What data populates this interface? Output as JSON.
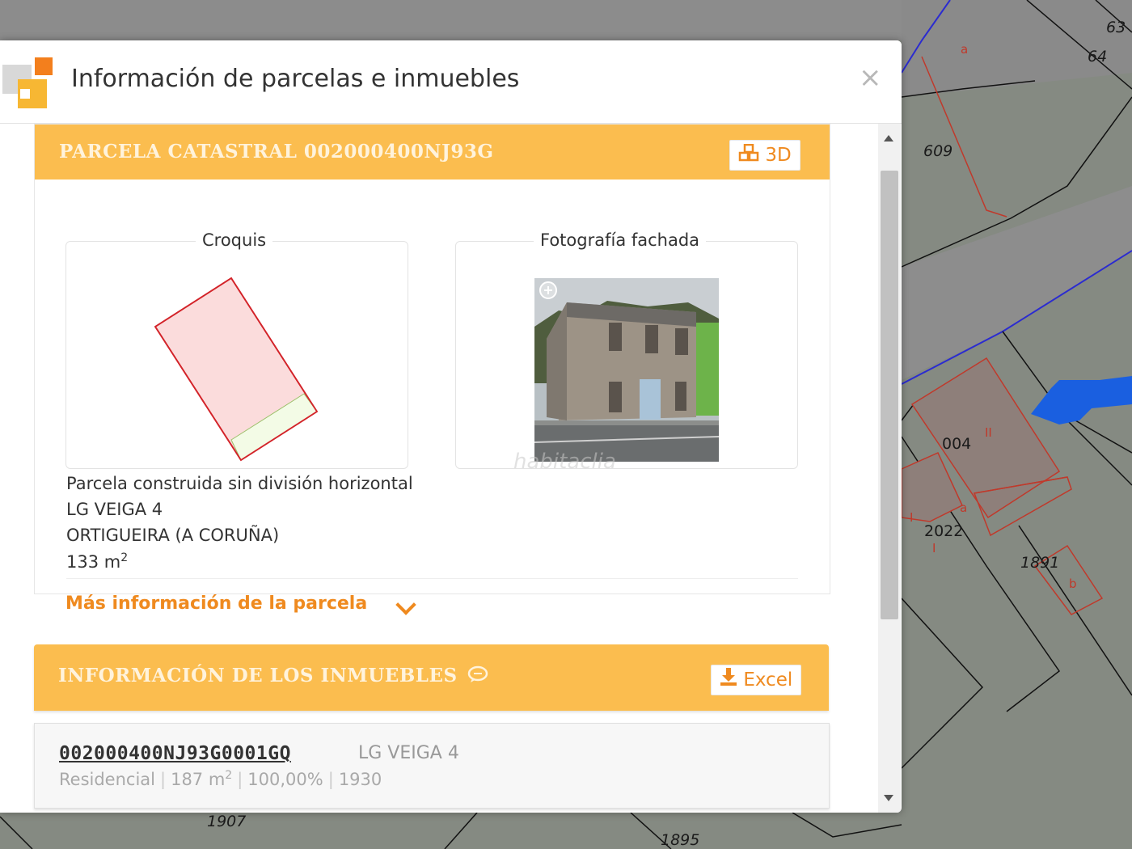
{
  "map": {
    "parcel_labels": [
      "63",
      "64",
      "609",
      "004",
      "2022",
      "1891",
      "1907",
      "1895"
    ],
    "small_labels": [
      "a",
      "a",
      "b",
      "I",
      "II",
      "I",
      "b"
    ]
  },
  "modal": {
    "title": "Información de parcelas e inmuebles",
    "close_symbol": "×"
  },
  "parcel_section": {
    "title": "PARCELA CATASTRAL 002000400NJ93G",
    "button_3d": "3D",
    "sketch_label": "Croquis",
    "photo_label": "Fotografía fachada",
    "description": "Parcela construida sin división horizontal",
    "address": "LG VEIGA 4",
    "municipality": "ORTIGUEIRA (A CORUÑA)",
    "area_value": "133 m",
    "area_unit_sup": "2",
    "more_info": "Más información de la parcela",
    "watermark": "habitaclia"
  },
  "properties_section": {
    "title": "INFORMACIÓN DE LOS INMUEBLES",
    "excel_button": "Excel",
    "items": [
      {
        "reference": "002000400NJ93G0001GQ",
        "address": "LG VEIGA 4",
        "use": "Residencial",
        "area": "187 m",
        "area_sup": "2",
        "share": "100,00%",
        "year": "1930"
      }
    ]
  },
  "colors": {
    "accent_orange": "#ef8a1f",
    "header_yellow": "#fbbd4f",
    "map_gray": "#858a82"
  }
}
